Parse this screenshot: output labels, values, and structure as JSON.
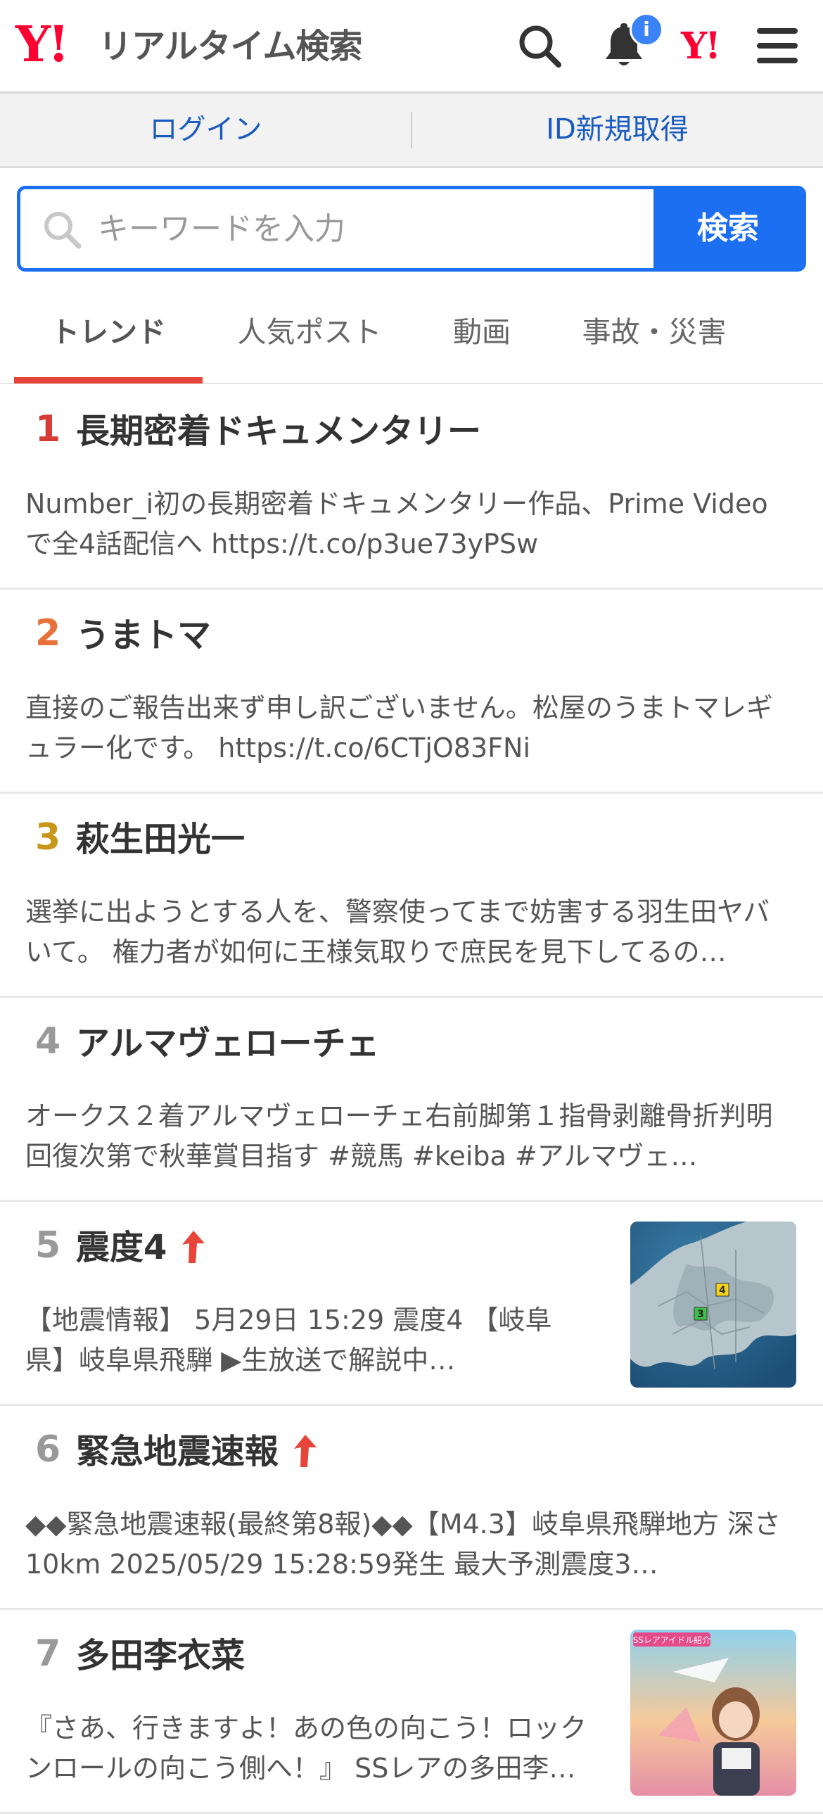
{
  "header": {
    "logo_mark": "Y!",
    "title": "リアルタイム検索",
    "notification_badge": "i",
    "yj_mark": "Y!"
  },
  "login": {
    "login_label": "ログイン",
    "register_label": "ID新規取得"
  },
  "search": {
    "placeholder": "キーワードを入力",
    "button_label": "検索"
  },
  "tabs": [
    {
      "label": "トレンド",
      "active": true
    },
    {
      "label": "人気ポスト",
      "active": false
    },
    {
      "label": "動画",
      "active": false
    },
    {
      "label": "事故・災害",
      "active": false
    }
  ],
  "trends": [
    {
      "rank": "1",
      "title": "長期密着ドキュメンタリー",
      "rising": false,
      "desc": "Number_i初の長期密着ドキュメンタリー作品、Prime Videoで全4話配信へ https://t.co/p3ue73yPSw"
    },
    {
      "rank": "2",
      "title": "うまトマ",
      "rising": false,
      "desc": "直接のご報告出来ず申し訳ございません。松屋のうまトマレギュラー化です。 https://t.co/6CTjO83FNi"
    },
    {
      "rank": "3",
      "title": "萩生田光一",
      "rising": false,
      "desc": "選挙に出ようとする人を、警察使ってまで妨害する羽生田ヤバいて。 権力者が如何に王様気取りで庶民を見下してるの…"
    },
    {
      "rank": "4",
      "title": "アルマヴェローチェ",
      "rising": false,
      "desc": "オークス２着アルマヴェローチェ右前脚第１指骨剥離骨折判明　回復次第で秋華賞目指す #競馬 #keiba #アルマヴェ…"
    },
    {
      "rank": "5",
      "title": "震度4",
      "rising": true,
      "desc": "【地震情報】 5月29日 15:29 震度4 【岐阜県】岐阜県飛騨 ▶生放送で解説中…",
      "map_labels": [
        "4",
        "3"
      ]
    },
    {
      "rank": "6",
      "title": "緊急地震速報",
      "rising": true,
      "desc": "◆◆緊急地震速報(最終第8報)◆◆【M4.3】岐阜県飛騨地方 深さ10km 2025/05/29 15:28:59発生 最大予測震度3…"
    },
    {
      "rank": "7",
      "title": "多田李衣菜",
      "rising": false,
      "desc": "『さあ、行きますよ！あの色の向こう！ロックンロールの向こう側へ！』 SSレアの多田李…",
      "image_caption": "SSレアアイドル紹介"
    }
  ],
  "colors": {
    "brand_red": "#ff0033",
    "accent_blue": "#1d6ff2",
    "link_blue": "#1a5bbf",
    "tab_underline": "#e5453a",
    "rank1": "#d63b35",
    "rank2": "#e8703a",
    "rank3": "#c9961a",
    "rank_other": "#999999"
  },
  "icons": {
    "search": "search-icon",
    "bell": "bell-icon",
    "menu": "hamburger-menu-icon",
    "rising": "up-arrow-icon"
  }
}
